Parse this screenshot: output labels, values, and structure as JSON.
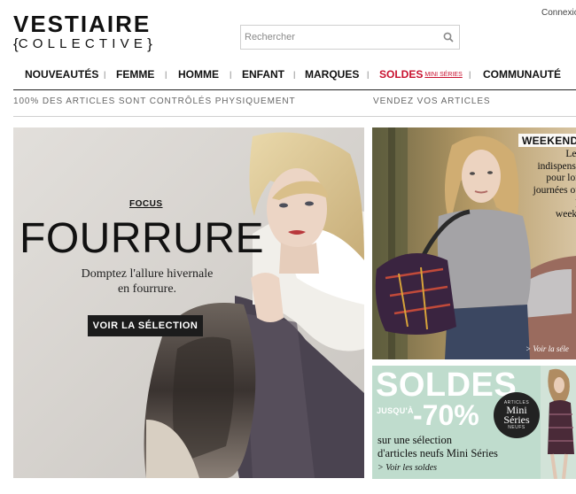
{
  "header": {
    "logo_top": "VESTIAIRE",
    "logo_bottom": "COLLECTIVE",
    "search_placeholder": "Rechercher",
    "connexion": "Connexion"
  },
  "nav": {
    "items": [
      {
        "label": "NOUVEAUTÉS"
      },
      {
        "label": "FEMME"
      },
      {
        "label": "HOMME"
      },
      {
        "label": "ENFANT"
      },
      {
        "label": "MARQUES"
      },
      {
        "label": "SOLDES",
        "sub": "MINI SÉRIES"
      },
      {
        "label": "COMMUNAUTÉ"
      }
    ],
    "separator": "|"
  },
  "subnav": {
    "left": "100% DES ARTICLES SONT CONTRÔLÉS PHYSIQUEMENT",
    "right": "VENDEZ VOS ARTICLES"
  },
  "hero": {
    "kicker": "FOCUS",
    "title": "FOURRURE",
    "desc_line1": "Domptez l'allure hivernale",
    "desc_line2": "en fourrure.",
    "cta": "VOIR LA SÉLECTION"
  },
  "weekend": {
    "title": "WEEKEND",
    "lines": [
      "Les",
      "indispensa",
      "pour lon",
      "journées ou p",
      "week-"
    ],
    "link": "> Voir la séle"
  },
  "soldes": {
    "title": "SOLDES",
    "upto": "JUSQU'À",
    "pct": "-70%",
    "badge_top": "ARTICLES",
    "badge_line1": "Mini",
    "badge_line2": "Séries",
    "badge_bottom": "NEUFS",
    "text_line1": "sur une sélection",
    "text_line2": "d'articles neufs Mini Séries",
    "link": "> Voir les soldes"
  },
  "colors": {
    "sale_red": "#c8102e",
    "cta_bg": "#1c1c1c",
    "soldes_bg": "#bfdccd"
  }
}
